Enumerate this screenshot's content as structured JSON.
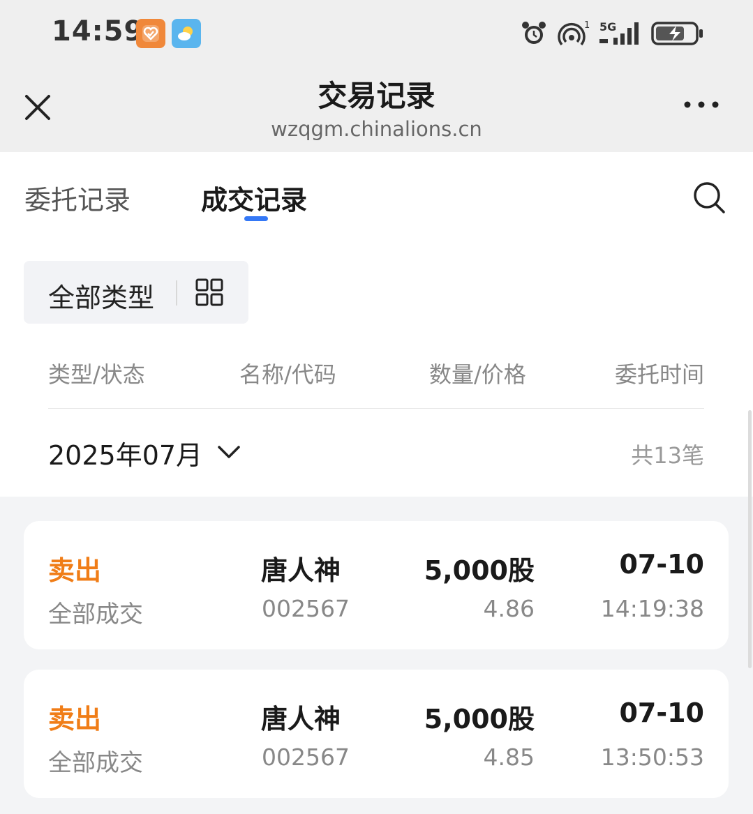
{
  "status_bar": {
    "time": "14:59",
    "signal_label": "5G",
    "sim_index": "1"
  },
  "nav": {
    "title": "交易记录",
    "url": "wzqgm.chinalions.cn"
  },
  "tabs": [
    {
      "label": "委托记录",
      "active": false
    },
    {
      "label": "成交记录",
      "active": true
    }
  ],
  "filter": {
    "label": "全部类型"
  },
  "columns": [
    "类型/状态",
    "名称/代码",
    "数量/价格",
    "委托时间"
  ],
  "month": {
    "label": "2025年07月",
    "total": "共13笔"
  },
  "records": [
    {
      "type": "卖出",
      "status": "全部成交",
      "name": "唐人神",
      "code": "002567",
      "qty": "5,000股",
      "price": "4.86",
      "date": "07-10",
      "time": "14:19:38"
    },
    {
      "type": "卖出",
      "status": "全部成交",
      "name": "唐人神",
      "code": "002567",
      "qty": "5,000股",
      "price": "4.85",
      "date": "07-10",
      "time": "13:50:53"
    }
  ],
  "colors": {
    "accent": "#3478f6",
    "sell": "#f07d17"
  }
}
